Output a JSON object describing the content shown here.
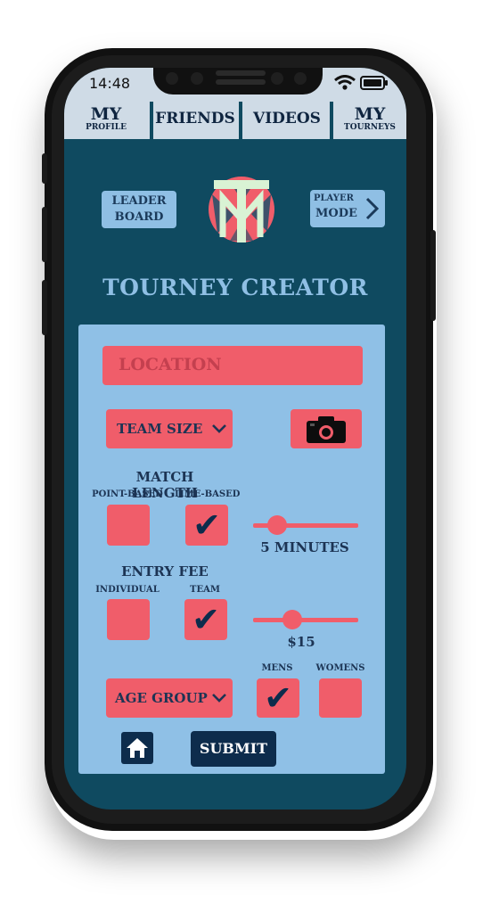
{
  "status": {
    "time": "14:48"
  },
  "nav": {
    "profile_main": "MY",
    "profile_sub": "PROFILE",
    "friends": "FRIENDS",
    "videos": "VIDEOS",
    "tourneys_main": "MY",
    "tourneys_sub": "TOURNEYS"
  },
  "header": {
    "leaderboard_line1": "LEADER",
    "leaderboard_line2": "BOARD",
    "player_line1": "PLAYER",
    "player_line2": "MODE"
  },
  "title": "TOURNEY CREATOR",
  "form": {
    "location_placeholder": "LOCATION",
    "team_size_label": "TEAM SIZE",
    "match_length": {
      "heading": "MATCH LENGTH",
      "point_based": "POINT-BASED",
      "time_based": "TIME-BASED",
      "point_based_checked": false,
      "time_based_checked": true,
      "slider_value_text": "5 MINUTES",
      "slider_fraction": 0.17
    },
    "entry_fee": {
      "heading": "ENTRY FEE",
      "individual": "INDIVIDUAL",
      "team": "TEAM",
      "individual_checked": false,
      "team_checked": true,
      "slider_value_text": "$15",
      "slider_fraction": 0.34
    },
    "age_group_label": "AGE GROUP",
    "mens": "MENS",
    "womens": "WOMENS",
    "mens_checked": true,
    "womens_checked": false,
    "submit": "SUBMIT"
  },
  "colors": {
    "screen_bg": "#0f4a60",
    "panel_bg": "#8fc0e6",
    "accent_coral": "#f05d6a",
    "navy": "#0d2c4c"
  },
  "icons": {
    "camera": "camera-icon",
    "home": "home-icon",
    "chevron": "chevron-down-icon",
    "player_arrow": "chevron-right-icon",
    "wifi": "wifi-icon",
    "battery": "battery-icon",
    "check": "checkmark-icon"
  }
}
